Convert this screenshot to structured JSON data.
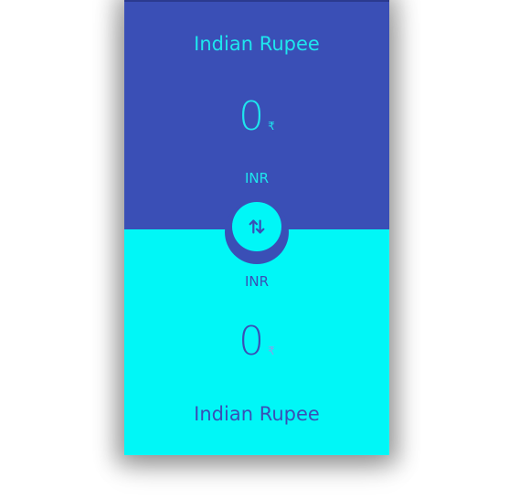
{
  "top_panel": {
    "currency_name": "Indian Rupee",
    "amount": "0",
    "symbol": "₹",
    "code": "INR"
  },
  "bottom_panel": {
    "code": "INR",
    "amount": "0",
    "symbol": "₹",
    "currency_name": "Indian Rupee"
  },
  "swap_button": {
    "icon": "swap-vertical-icon"
  },
  "colors": {
    "primary": "#3a4fb6",
    "accent": "#00f7f7"
  }
}
